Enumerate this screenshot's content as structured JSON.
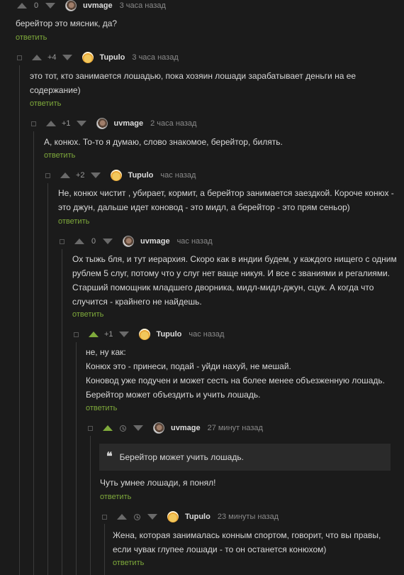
{
  "reply_label": "ответить",
  "colors": {
    "accent": "#7faa3b",
    "background": "#1b1b1b",
    "quote_bg": "#2a2a2a"
  },
  "comments": [
    {
      "author": "uvmage",
      "rating": "0",
      "time": "3 часа назад",
      "lines": [
        "берейтор это мясник, да?"
      ]
    },
    {
      "author": "Tupulo",
      "rating": "+4",
      "time": "3 часа назад",
      "lines": [
        "это тот, кто занимается лошадью, пока хозяин лошади зарабатывает деньги на ее",
        "содержание)"
      ]
    },
    {
      "author": "uvmage",
      "rating": "+1",
      "time": "2 часа назад",
      "lines": [
        "А, конюх. То-то я думаю, слово знакомое, берейтор, билять."
      ]
    },
    {
      "author": "Tupulo",
      "rating": "+2",
      "time": "час назад",
      "lines": [
        "Не, конюх чистит , убирает, кормит, а берейтор занимается заездкой. Короче конюх -",
        "это джун, дальше идет коновод - это мидл, а берейтор - это прям сеньор)"
      ]
    },
    {
      "author": "uvmage",
      "rating": "0",
      "time": "час назад",
      "lines": [
        "Ох тыжь бля, и тут иерархия. Скоро как в индии будем, у каждого нищего с одним",
        "рублем 5 слуг, потому что у слуг нет ваще никуя. И все с званиями и регалиями.",
        "Старший помощник младшего дворника, мидл-мидл-джун, сцук. А когда что",
        "случится - крайнего не найдешь."
      ]
    },
    {
      "author": "Tupulo",
      "rating": "+1",
      "time": "час назад",
      "lines": [
        "не, ну как:",
        "Конюх это - принеси, подай - уйди нахуй, не мешай.",
        "Коновод уже подучен и может сесть на более менее объезженную лошадь.",
        "Берейтор может объездить и учить лошадь."
      ]
    },
    {
      "author": "uvmage",
      "rating": "",
      "time": "27 минут назад",
      "quote": "Берейтор может учить лошадь.",
      "lines": [
        "Чуть умнее лошади, я понял!"
      ]
    },
    {
      "author": "Tupulo",
      "rating": "",
      "time": "23 минуты назад",
      "lines": [
        "Жена, которая занималась конным спортом, говорит, что вы правы,",
        "если чувак глупее лошади - то он останется конюхом)"
      ]
    }
  ]
}
